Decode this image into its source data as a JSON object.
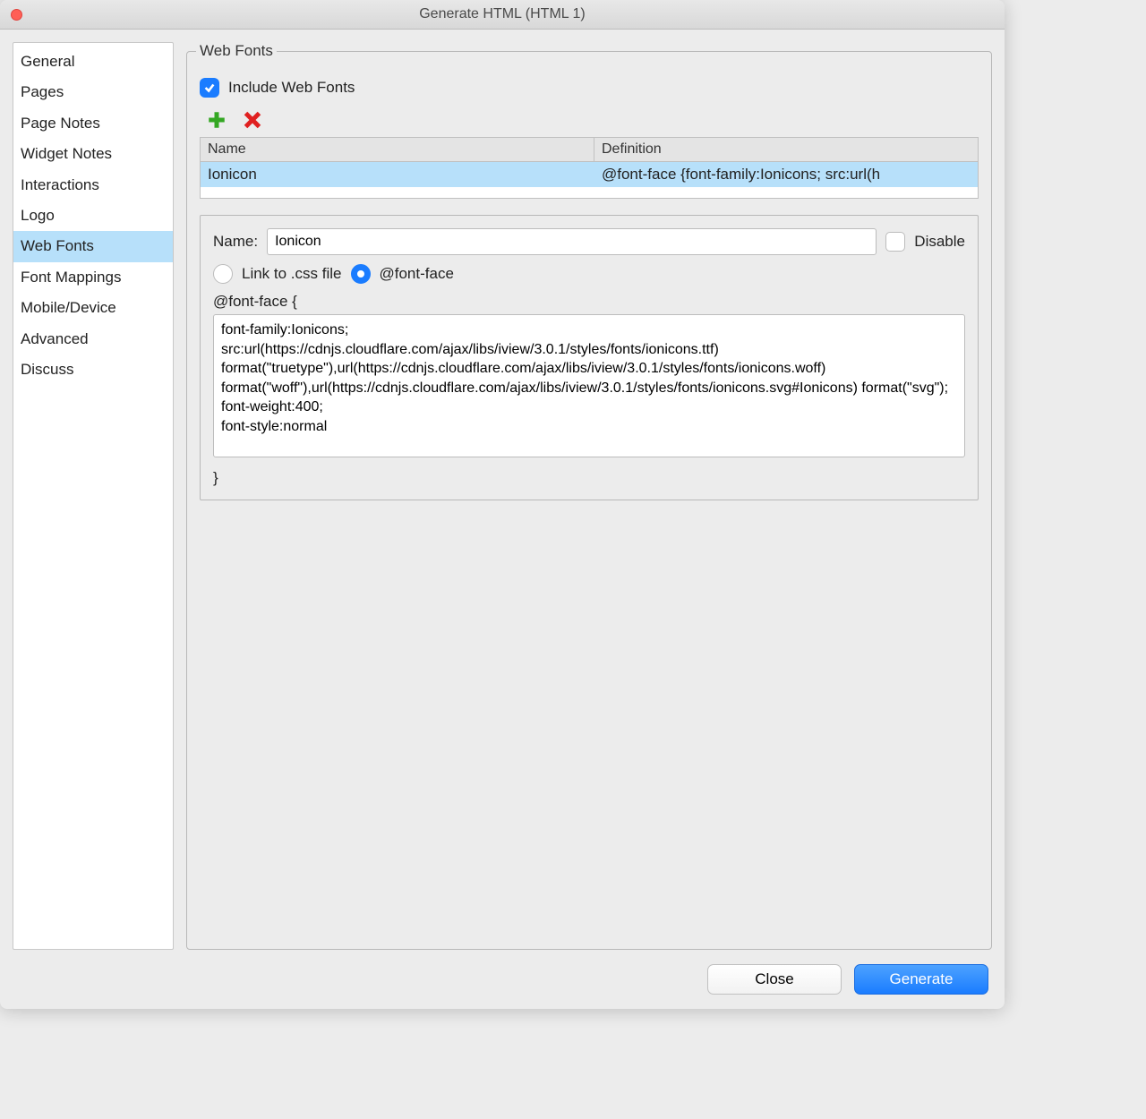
{
  "window": {
    "title": "Generate HTML (HTML 1)"
  },
  "sidebar": {
    "items": [
      {
        "label": "General"
      },
      {
        "label": "Pages"
      },
      {
        "label": "Page Notes"
      },
      {
        "label": "Widget Notes"
      },
      {
        "label": "Interactions"
      },
      {
        "label": "Logo"
      },
      {
        "label": "Web Fonts",
        "selected": true
      },
      {
        "label": "Font Mappings"
      },
      {
        "label": "Mobile/Device"
      },
      {
        "label": "Advanced"
      },
      {
        "label": "Discuss"
      }
    ]
  },
  "section": {
    "legend": "Web Fonts",
    "include_label": "Include Web Fonts",
    "include_checked": true,
    "table": {
      "headers": {
        "name": "Name",
        "definition": "Definition"
      },
      "rows": [
        {
          "name": "Ionicon",
          "definition": "@font-face {font-family:Ionicons; src:url(h"
        }
      ]
    },
    "details": {
      "name_label": "Name:",
      "name_value": "Ionicon",
      "disable_label": "Disable",
      "disable_checked": false,
      "radio_css_label": "Link to .css file",
      "radio_fontface_label": "@font-face",
      "radio_selected": "fontface",
      "fontface_open": "@font-face {",
      "fontface_body": "font-family:Ionicons;\nsrc:url(https://cdnjs.cloudflare.com/ajax/libs/iview/3.0.1/styles/fonts/ionicons.ttf) format(\"truetype\"),url(https://cdnjs.cloudflare.com/ajax/libs/iview/3.0.1/styles/fonts/ionicons.woff) format(\"woff\"),url(https://cdnjs.cloudflare.com/ajax/libs/iview/3.0.1/styles/fonts/ionicons.svg#Ionicons) format(\"svg\");\nfont-weight:400;\nfont-style:normal",
      "fontface_close": "}"
    }
  },
  "footer": {
    "close": "Close",
    "generate": "Generate"
  }
}
